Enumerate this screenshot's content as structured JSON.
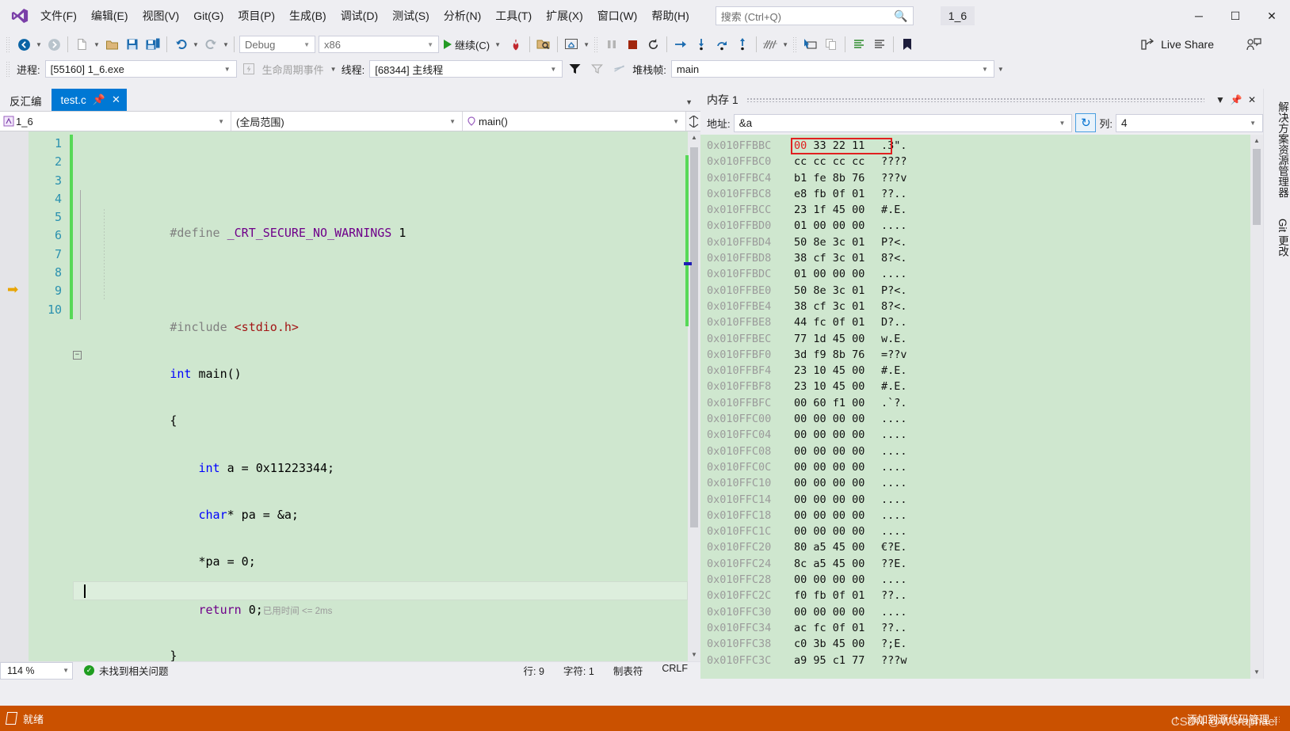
{
  "window": {
    "title": "1_6",
    "minimize_label": "─",
    "maximize_label": "☐",
    "close_label": "✕"
  },
  "menu": {
    "items": [
      {
        "label": "文件(F)"
      },
      {
        "label": "编辑(E)"
      },
      {
        "label": "视图(V)"
      },
      {
        "label": "Git(G)"
      },
      {
        "label": "项目(P)"
      },
      {
        "label": "生成(B)"
      },
      {
        "label": "调试(D)"
      },
      {
        "label": "测试(S)"
      },
      {
        "label": "分析(N)"
      },
      {
        "label": "工具(T)"
      },
      {
        "label": "扩展(X)"
      },
      {
        "label": "窗口(W)"
      },
      {
        "label": "帮助(H)"
      }
    ]
  },
  "search": {
    "placeholder": "搜索 (Ctrl+Q)",
    "icon": "search-icon"
  },
  "toolbar": {
    "configuration": "Debug",
    "platform": "x86",
    "continue_label": "继续(C)",
    "live_share_label": "Live Share"
  },
  "debugbar": {
    "process_label": "进程:",
    "process_value": "[55160] 1_6.exe",
    "lifecycle_label": "生命周期事件",
    "thread_label": "线程:",
    "thread_value": "[68344] 主线程",
    "stackframe_label": "堆栈帧:",
    "stackframe_value": "main"
  },
  "editor": {
    "tab_disassembly": "反汇编",
    "tab_active": "test.c",
    "nav_project": "1_6",
    "nav_scope": "(全局范围)",
    "nav_member": "main()",
    "timing_annotation": "已用时间 <= 2ms",
    "current_line": 9,
    "lines": [
      {
        "n": 1,
        "tokens": [
          {
            "t": "#define ",
            "c": "pre"
          },
          {
            "t": "_CRT_SECURE_NO_WARNINGS",
            "c": "macro"
          },
          {
            "t": " 1",
            "c": "plain"
          }
        ]
      },
      {
        "n": 2,
        "tokens": []
      },
      {
        "n": 3,
        "tokens": [
          {
            "t": "#include ",
            "c": "pre"
          },
          {
            "t": "<stdio.h>",
            "c": "hdr"
          }
        ]
      },
      {
        "n": 4,
        "tokens": [
          {
            "t": "int",
            "c": "kw"
          },
          {
            "t": " main()",
            "c": "plain"
          }
        ]
      },
      {
        "n": 5,
        "tokens": [
          {
            "t": "{",
            "c": "plain"
          }
        ]
      },
      {
        "n": 6,
        "tokens": [
          {
            "t": "    ",
            "c": "plain"
          },
          {
            "t": "int",
            "c": "kw"
          },
          {
            "t": " a = 0x11223344;",
            "c": "plain"
          }
        ]
      },
      {
        "n": 7,
        "tokens": [
          {
            "t": "    ",
            "c": "plain"
          },
          {
            "t": "char",
            "c": "kw"
          },
          {
            "t": "* pa = &a;",
            "c": "plain"
          }
        ]
      },
      {
        "n": 8,
        "tokens": [
          {
            "t": "    *pa = 0;",
            "c": "plain"
          }
        ]
      },
      {
        "n": 9,
        "tokens": [
          {
            "t": "    ",
            "c": "plain"
          },
          {
            "t": "return",
            "c": "macro"
          },
          {
            "t": " 0;",
            "c": "plain"
          }
        ]
      },
      {
        "n": 10,
        "tokens": [
          {
            "t": "}",
            "c": "plain"
          }
        ]
      }
    ],
    "status": {
      "zoom": "114 %",
      "problems": "未找到相关问题",
      "line": "行: 9",
      "column": "字符: 1",
      "tabs": "制表符",
      "eol": "CRLF"
    }
  },
  "memory": {
    "title": "内存 1",
    "address_label": "地址:",
    "address_value": "&a",
    "columns_label": "列:",
    "columns_value": "4",
    "refresh_icon": "refresh-icon",
    "highlight_row_index": 0,
    "rows": [
      {
        "addr": "0x010FFBBC",
        "bytes": "00 33 22 11",
        "ascii": ".3\".",
        "red_first": true
      },
      {
        "addr": "0x010FFBC0",
        "bytes": "cc cc cc cc",
        "ascii": "????"
      },
      {
        "addr": "0x010FFBC4",
        "bytes": "b1 fe 8b 76",
        "ascii": "???v"
      },
      {
        "addr": "0x010FFBC8",
        "bytes": "e8 fb 0f 01",
        "ascii": "??.."
      },
      {
        "addr": "0x010FFBCC",
        "bytes": "23 1f 45 00",
        "ascii": "#.E."
      },
      {
        "addr": "0x010FFBD0",
        "bytes": "01 00 00 00",
        "ascii": "...."
      },
      {
        "addr": "0x010FFBD4",
        "bytes": "50 8e 3c 01",
        "ascii": "P?<."
      },
      {
        "addr": "0x010FFBD8",
        "bytes": "38 cf 3c 01",
        "ascii": "8?<."
      },
      {
        "addr": "0x010FFBDC",
        "bytes": "01 00 00 00",
        "ascii": "...."
      },
      {
        "addr": "0x010FFBE0",
        "bytes": "50 8e 3c 01",
        "ascii": "P?<."
      },
      {
        "addr": "0x010FFBE4",
        "bytes": "38 cf 3c 01",
        "ascii": "8?<."
      },
      {
        "addr": "0x010FFBE8",
        "bytes": "44 fc 0f 01",
        "ascii": "D?.."
      },
      {
        "addr": "0x010FFBEC",
        "bytes": "77 1d 45 00",
        "ascii": "w.E."
      },
      {
        "addr": "0x010FFBF0",
        "bytes": "3d f9 8b 76",
        "ascii": "=??v"
      },
      {
        "addr": "0x010FFBF4",
        "bytes": "23 10 45 00",
        "ascii": "#.E."
      },
      {
        "addr": "0x010FFBF8",
        "bytes": "23 10 45 00",
        "ascii": "#.E."
      },
      {
        "addr": "0x010FFBFC",
        "bytes": "00 60 f1 00",
        "ascii": ".`?."
      },
      {
        "addr": "0x010FFC00",
        "bytes": "00 00 00 00",
        "ascii": "...."
      },
      {
        "addr": "0x010FFC04",
        "bytes": "00 00 00 00",
        "ascii": "...."
      },
      {
        "addr": "0x010FFC08",
        "bytes": "00 00 00 00",
        "ascii": "...."
      },
      {
        "addr": "0x010FFC0C",
        "bytes": "00 00 00 00",
        "ascii": "...."
      },
      {
        "addr": "0x010FFC10",
        "bytes": "00 00 00 00",
        "ascii": "...."
      },
      {
        "addr": "0x010FFC14",
        "bytes": "00 00 00 00",
        "ascii": "...."
      },
      {
        "addr": "0x010FFC18",
        "bytes": "00 00 00 00",
        "ascii": "...."
      },
      {
        "addr": "0x010FFC1C",
        "bytes": "00 00 00 00",
        "ascii": "...."
      },
      {
        "addr": "0x010FFC20",
        "bytes": "80 a5 45 00",
        "ascii": "€?E."
      },
      {
        "addr": "0x010FFC24",
        "bytes": "8c a5 45 00",
        "ascii": "??E."
      },
      {
        "addr": "0x010FFC28",
        "bytes": "00 00 00 00",
        "ascii": "...."
      },
      {
        "addr": "0x010FFC2C",
        "bytes": "f0 fb 0f 01",
        "ascii": "??.."
      },
      {
        "addr": "0x010FFC30",
        "bytes": "00 00 00 00",
        "ascii": "...."
      },
      {
        "addr": "0x010FFC34",
        "bytes": "ac fc 0f 01",
        "ascii": "??.."
      },
      {
        "addr": "0x010FFC38",
        "bytes": "c0 3b 45 00",
        "ascii": "?;E."
      },
      {
        "addr": "0x010FFC3C",
        "bytes": "a9 95 c1 77",
        "ascii": "???w"
      }
    ]
  },
  "rsidebar": {
    "items": [
      {
        "label": "解决方案资源管理器"
      },
      {
        "label": "Git 更改"
      }
    ]
  },
  "statusbar": {
    "ready": "就绪",
    "source_control": "添加到源代码管理",
    "watermark": "CSDN @Weraphael",
    "accent_color": "#ca5100"
  }
}
